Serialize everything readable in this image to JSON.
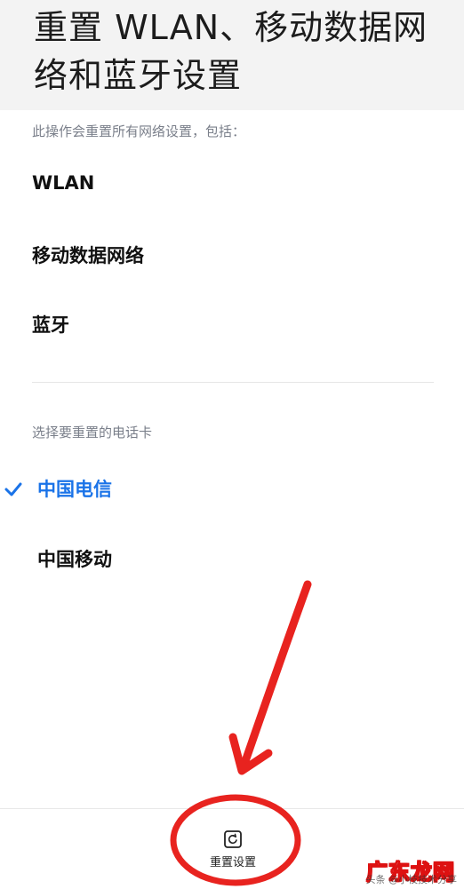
{
  "header": {
    "title": "重置 WLAN、移动数据网络和蓝牙设置"
  },
  "reset_scope": {
    "description": "此操作会重置所有网络设置，包括：",
    "items": [
      "WLAN",
      "移动数据网络",
      "蓝牙"
    ]
  },
  "sim_selection": {
    "description": "选择要重置的电话卡",
    "options": [
      {
        "label": "中国电信",
        "selected": true
      },
      {
        "label": "中国移动",
        "selected": false
      }
    ],
    "selected_color": "#1a73e8"
  },
  "bottom_bar": {
    "reset_button_label": "重置设置",
    "reset_icon": "reset-icon"
  },
  "annotation": {
    "color": "#e8231f",
    "shapes": [
      "arrow",
      "circle"
    ]
  },
  "watermark": {
    "logo_text": "广东龙网",
    "sub_text": "头条 @小枝技术分享"
  }
}
